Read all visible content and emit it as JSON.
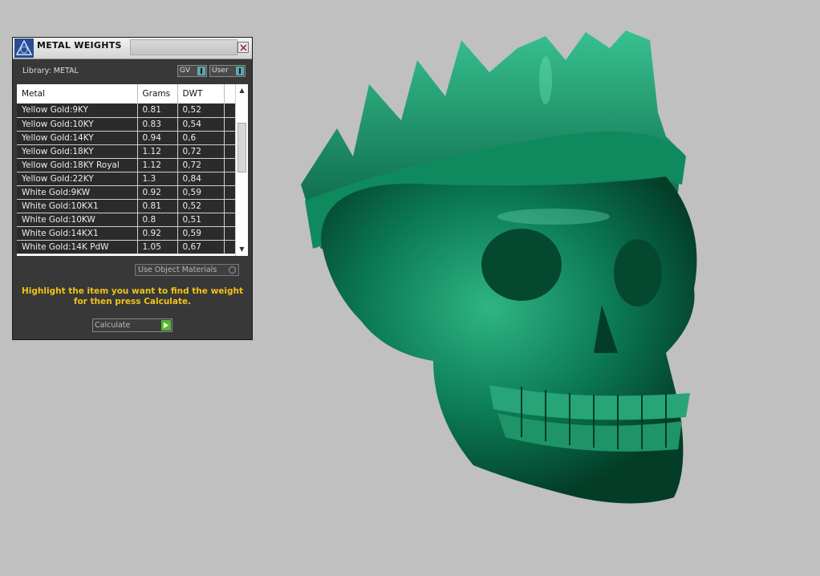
{
  "window": {
    "title": "METAL WEIGHTS"
  },
  "library": {
    "label": "Library: METAL"
  },
  "toggles": {
    "gv_label": "GV",
    "user_label": "User"
  },
  "table": {
    "columns": [
      "Metal",
      "Grams",
      "DWT"
    ],
    "rows": [
      [
        "Yellow Gold:9KY",
        "0.81",
        "0,52"
      ],
      [
        "Yellow Gold:10KY",
        "0.83",
        "0,54"
      ],
      [
        "Yellow Gold:14KY",
        "0.94",
        "0,6"
      ],
      [
        "Yellow Gold:18KY",
        "1.12",
        "0,72"
      ],
      [
        "Yellow Gold:18KY Royal",
        "1.12",
        "0,72"
      ],
      [
        "Yellow Gold:22KY",
        "1.3",
        "0,84"
      ],
      [
        "White Gold:9KW",
        "0.92",
        "0,59"
      ],
      [
        "White Gold:10KX1",
        "0.81",
        "0,52"
      ],
      [
        "White Gold:10KW",
        "0.8",
        "0,51"
      ],
      [
        "White Gold:14KX1",
        "0.92",
        "0,59"
      ],
      [
        "White Gold:14K PdW",
        "1.05",
        "0,67"
      ]
    ]
  },
  "use_object_materials": {
    "label": "Use Object Materials"
  },
  "hint": {
    "text": "Highlight the item you want to find the weight for then press Calculate."
  },
  "calculate": {
    "label": "Calculate"
  },
  "colors": {
    "model": "#0b7a55",
    "background": "#c0c0c0",
    "hint": "#f2c21a",
    "panel": "#383838"
  },
  "icons": [
    "app-logo-icon",
    "close-icon",
    "scroll-up-icon",
    "scroll-down-icon",
    "play-arrow-icon"
  ]
}
